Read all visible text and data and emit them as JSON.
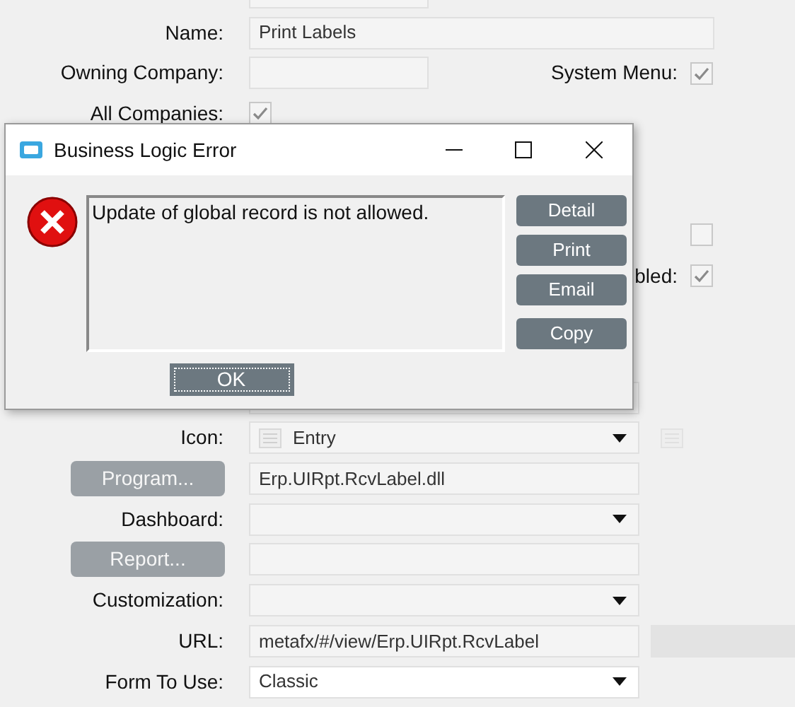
{
  "form": {
    "rows": [
      {
        "kind": "field",
        "label": "",
        "value": "",
        "short": true
      },
      {
        "kind": "field",
        "label": "Name:",
        "value": "Print Labels",
        "short": false
      },
      {
        "kind": "field",
        "label": "Owning Company:",
        "value": "",
        "short": true,
        "side_label": "System Menu:",
        "side_checked": true
      },
      {
        "kind": "check",
        "label": "All Companies:",
        "checked": true
      },
      {
        "kind": "blank"
      },
      {
        "kind": "blank"
      },
      {
        "kind": "blank",
        "side_label": "",
        "side_checked": false
      },
      {
        "kind": "blank",
        "side_label": "bled:",
        "side_checked": true
      },
      {
        "kind": "blank"
      },
      {
        "kind": "blank"
      },
      {
        "kind": "field",
        "label": "",
        "value": "",
        "short": false
      },
      {
        "kind": "combo",
        "label": "Icon:",
        "value": "Entry",
        "icon": true
      },
      {
        "kind": "button",
        "label": "Program...",
        "value": "Erp.UIRpt.RcvLabel.dll"
      },
      {
        "kind": "combo",
        "label": "Dashboard:",
        "value": ""
      },
      {
        "kind": "button",
        "label": "Report...",
        "value": ""
      },
      {
        "kind": "combo",
        "label": "Customization:",
        "value": ""
      },
      {
        "kind": "field",
        "label": "URL:",
        "value": "metafx/#/view/Erp.UIRpt.RcvLabel",
        "short": false,
        "bar": true
      },
      {
        "kind": "select",
        "label": "Form To Use:",
        "value": "Classic"
      }
    ]
  },
  "dialog": {
    "title": "Business Logic Error",
    "message": "Update of global record is not allowed.",
    "buttons": [
      "Detail",
      "Print",
      "Email",
      "Copy"
    ],
    "ok": "OK"
  }
}
